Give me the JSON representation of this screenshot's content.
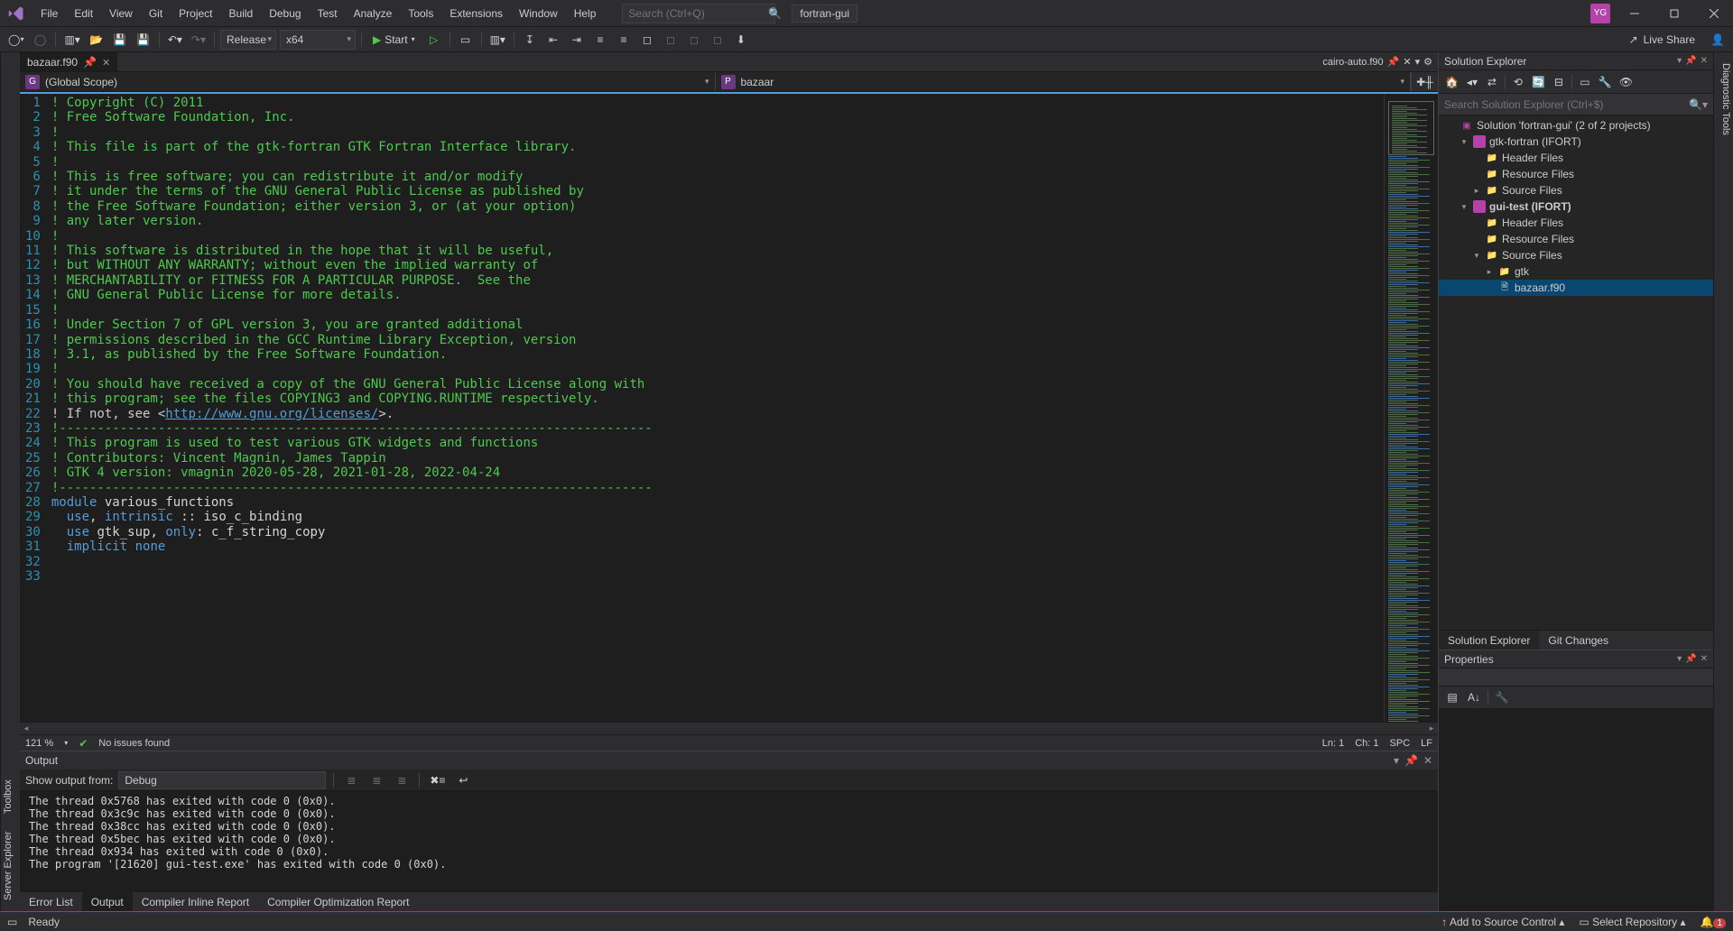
{
  "menu": [
    "File",
    "Edit",
    "View",
    "Git",
    "Project",
    "Build",
    "Debug",
    "Test",
    "Analyze",
    "Tools",
    "Extensions",
    "Window",
    "Help"
  ],
  "search_placeholder": "Search (Ctrl+Q)",
  "config_name": "fortran-gui",
  "avatar_initials": "YG",
  "toolbar": {
    "config_dropdown": "Release",
    "platform_dropdown": "x64",
    "start_label": "Start",
    "live_share": "Live Share"
  },
  "left_side_tabs": [
    "Server Explorer",
    "Toolbox"
  ],
  "right_side_tabs": [
    "Diagnostic Tools"
  ],
  "editor": {
    "active_tab": "bazaar.f90",
    "header_right": {
      "filename": "cairo-auto.f90"
    },
    "scope_left_badge": "G",
    "scope_left": "(Global Scope)",
    "scope_right_badge": "P",
    "scope_right": "bazaar",
    "zoom": "121 %",
    "issues": "No issues found",
    "position": "Ln: 1",
    "column": "Ch: 1",
    "spaces": "SPC",
    "line_ending": "LF",
    "code": [
      {
        "n": 1,
        "cls": "c-com",
        "t": "! Copyright (C) 2011"
      },
      {
        "n": 2,
        "cls": "c-com",
        "t": "! Free Software Foundation, Inc."
      },
      {
        "n": 3,
        "cls": "c-com",
        "t": "!"
      },
      {
        "n": 4,
        "cls": "c-com",
        "t": "! This file is part of the gtk-fortran GTK Fortran Interface library."
      },
      {
        "n": 5,
        "cls": "c-com",
        "t": "!"
      },
      {
        "n": 6,
        "cls": "c-com",
        "t": "! This is free software; you can redistribute it and/or modify"
      },
      {
        "n": 7,
        "cls": "c-com",
        "t": "! it under the terms of the GNU General Public License as published by"
      },
      {
        "n": 8,
        "cls": "c-com",
        "t": "! the Free Software Foundation; either version 3, or (at your option)"
      },
      {
        "n": 9,
        "cls": "c-com",
        "t": "! any later version."
      },
      {
        "n": 10,
        "cls": "c-com",
        "t": "!"
      },
      {
        "n": 11,
        "cls": "c-com",
        "t": "! This software is distributed in the hope that it will be useful,"
      },
      {
        "n": 12,
        "cls": "c-com",
        "t": "! but WITHOUT ANY WARRANTY; without even the implied warranty of"
      },
      {
        "n": 13,
        "cls": "c-com",
        "t": "! MERCHANTABILITY or FITNESS FOR A PARTICULAR PURPOSE.  See the"
      },
      {
        "n": 14,
        "cls": "c-com",
        "t": "! GNU General Public License for more details."
      },
      {
        "n": 15,
        "cls": "c-com",
        "t": "!"
      },
      {
        "n": 16,
        "cls": "c-com",
        "t": "! Under Section 7 of GPL version 3, you are granted additional"
      },
      {
        "n": 17,
        "cls": "c-com",
        "t": "! permissions described in the GCC Runtime Library Exception, version"
      },
      {
        "n": 18,
        "cls": "c-com",
        "t": "! 3.1, as published by the Free Software Foundation."
      },
      {
        "n": 19,
        "cls": "c-com",
        "t": "!"
      },
      {
        "n": 20,
        "cls": "c-com",
        "t": "! You should have received a copy of the GNU General Public License along with"
      },
      {
        "n": 21,
        "cls": "c-com",
        "t": "! this program; see the files COPYING3 and COPYING.RUNTIME respectively."
      },
      {
        "n": 22,
        "cls": "c-com",
        "html": "! If not, see &lt;<span class=\"c-url\">http://www.gnu.org/licenses/</span>&gt;."
      },
      {
        "n": 23,
        "cls": "c-com",
        "t": "!------------------------------------------------------------------------------"
      },
      {
        "n": 24,
        "cls": "c-com",
        "t": "! This program is used to test various GTK widgets and functions"
      },
      {
        "n": 25,
        "cls": "c-com",
        "t": "! Contributors: Vincent Magnin, James Tappin"
      },
      {
        "n": 26,
        "cls": "c-com",
        "t": "! GTK 4 version: vmagnin 2020-05-28, 2021-01-28, 2022-04-24"
      },
      {
        "n": 27,
        "cls": "c-com",
        "t": "!------------------------------------------------------------------------------"
      },
      {
        "n": 28,
        "cls": "",
        "t": ""
      },
      {
        "n": 29,
        "cls": "",
        "html": "<span class=\"c-key\">module</span> <span class=\"c-id\">various_functions</span>"
      },
      {
        "n": 30,
        "cls": "",
        "html": "  <span class=\"c-key\">use</span><span class=\"c-punc\">,</span> <span class=\"c-key\">intrinsic</span> <span class=\"c-punc\">::</span> <span class=\"c-id\">iso_c_binding</span>"
      },
      {
        "n": 31,
        "cls": "",
        "html": "  <span class=\"c-key\">use</span> <span class=\"c-id\">gtk_sup</span><span class=\"c-punc\">,</span> <span class=\"c-key\">only</span><span class=\"c-punc\">:</span> <span class=\"c-id\">c_f_string_copy</span>"
      },
      {
        "n": 32,
        "cls": "",
        "html": "  <span class=\"c-key\">implicit</span> <span class=\"c-key\">none</span>"
      },
      {
        "n": 33,
        "cls": "",
        "t": ""
      }
    ]
  },
  "output": {
    "title": "Output",
    "show_from_label": "Show output from:",
    "source": "Debug",
    "lines": [
      "The thread 0x5768 has exited with code 0 (0x0).",
      "The thread 0x3c9c has exited with code 0 (0x0).",
      "The thread 0x38cc has exited with code 0 (0x0).",
      "The thread 0x5bec has exited with code 0 (0x0).",
      "The thread 0x934 has exited with code 0 (0x0).",
      "The program '[21620] gui-test.exe' has exited with code 0 (0x0)."
    ]
  },
  "bottom_tabs": [
    "Error List",
    "Output",
    "Compiler Inline Report",
    "Compiler Optimization Report"
  ],
  "bottom_active": 1,
  "solution_explorer": {
    "title": "Solution Explorer",
    "search_placeholder": "Search Solution Explorer (Ctrl+$)",
    "tree": [
      {
        "depth": 0,
        "tw": "",
        "icon": "sln",
        "label": "Solution 'fortran-gui' (2 of 2 projects)"
      },
      {
        "depth": 1,
        "tw": "▾",
        "icon": "proj",
        "label": "gtk-fortran (IFORT)"
      },
      {
        "depth": 2,
        "tw": "",
        "icon": "folder",
        "label": "Header Files"
      },
      {
        "depth": 2,
        "tw": "",
        "icon": "folder",
        "label": "Resource Files"
      },
      {
        "depth": 2,
        "tw": "▸",
        "icon": "folder",
        "label": "Source Files"
      },
      {
        "depth": 1,
        "tw": "▾",
        "icon": "proj",
        "label": "gui-test (IFORT)",
        "bold": true
      },
      {
        "depth": 2,
        "tw": "",
        "icon": "folder",
        "label": "Header Files"
      },
      {
        "depth": 2,
        "tw": "",
        "icon": "folder",
        "label": "Resource Files"
      },
      {
        "depth": 2,
        "tw": "▾",
        "icon": "folder",
        "label": "Source Files"
      },
      {
        "depth": 3,
        "tw": "▸",
        "icon": "folder",
        "label": "gtk"
      },
      {
        "depth": 3,
        "tw": "",
        "icon": "file",
        "label": "bazaar.f90",
        "selected": true
      }
    ],
    "tabs": [
      "Solution Explorer",
      "Git Changes"
    ],
    "active_tab": 0
  },
  "properties": {
    "title": "Properties"
  },
  "statusbar": {
    "ready": "Ready",
    "add_source_control": "Add to Source Control",
    "select_repo": "Select Repository",
    "notif_count": "1"
  }
}
